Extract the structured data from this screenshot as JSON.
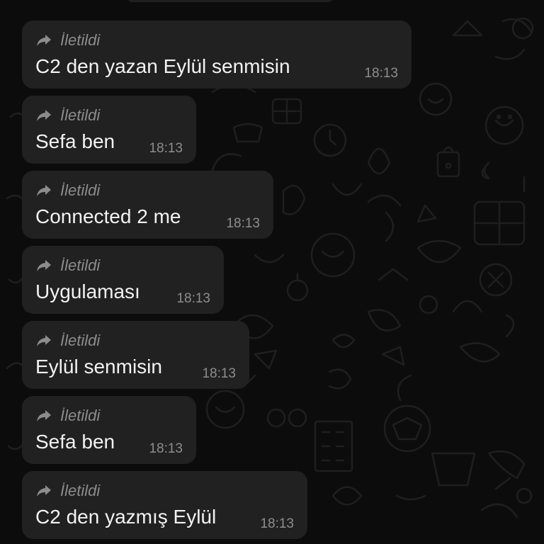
{
  "chat": {
    "messages": [
      {
        "forwarded_label": "İletildi",
        "text": "C2 den yazan Eylül senmisin",
        "time": "18:13"
      },
      {
        "forwarded_label": "İletildi",
        "text": "Sefa ben",
        "time": "18:13"
      },
      {
        "forwarded_label": "İletildi",
        "text": "Connected 2 me",
        "time": "18:13"
      },
      {
        "forwarded_label": "İletildi",
        "text": "Uygulaması",
        "time": "18:13"
      },
      {
        "forwarded_label": "İletildi",
        "text": "Eylül senmisin",
        "time": "18:13"
      },
      {
        "forwarded_label": "İletildi",
        "text": "Sefa ben",
        "time": "18:13"
      },
      {
        "forwarded_label": "İletildi",
        "text": "C2 den yazmış Eylül",
        "time": "18:13"
      }
    ]
  },
  "colors": {
    "background": "#0c0c0c",
    "bubble": "#212121",
    "text": "#f2f2f2",
    "meta": "#8c8c8c"
  },
  "icons": {
    "forwarded": "forward-arrow-icon",
    "wallpaper": "doodle-pattern"
  }
}
